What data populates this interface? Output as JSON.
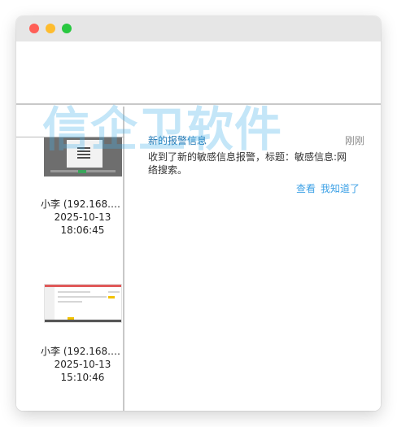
{
  "watermark": "信企卫软件",
  "thumbnails": [
    {
      "user": "小李 (192.168.1...",
      "date": "2025-10-13",
      "time": "18:06:45"
    },
    {
      "user": "小李 (192.168.1...",
      "date": "2025-10-13",
      "time": "15:10:46"
    }
  ],
  "alert": {
    "title": "新的报警信息",
    "time": "刚刚",
    "body": "收到了新的敏感信息报警，标题：敏感信息:网络搜索。",
    "actions": {
      "view": "查看",
      "ack": "我知道了"
    }
  },
  "colors": {
    "accent": "#3da1e6",
    "title_blue": "#1f77b4"
  }
}
